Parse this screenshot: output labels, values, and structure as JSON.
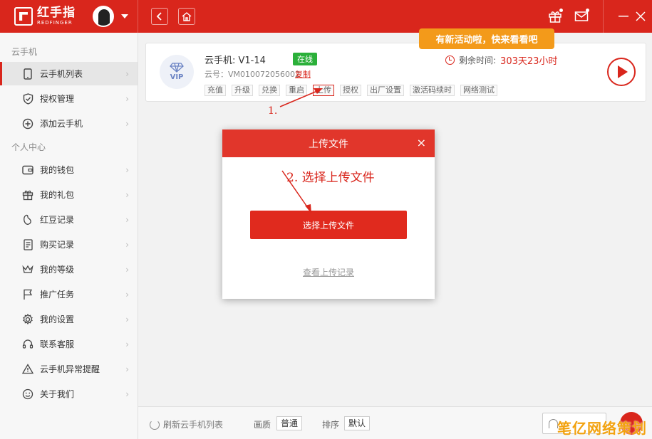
{
  "app": {
    "logo_cn": "红手指",
    "logo_en": "REDFINGER",
    "promo": "有新活动啦，快来看看吧"
  },
  "sidebar": {
    "group1": "云手机",
    "group2": "个人中心",
    "items": [
      {
        "label": "云手机列表",
        "icon": "phone-icon"
      },
      {
        "label": "授权管理",
        "icon": "shield-icon"
      },
      {
        "label": "添加云手机",
        "icon": "plus-circle-icon"
      },
      {
        "label": "我的钱包",
        "icon": "wallet-icon"
      },
      {
        "label": "我的礼包",
        "icon": "gift-icon"
      },
      {
        "label": "红豆记录",
        "icon": "bean-icon"
      },
      {
        "label": "购买记录",
        "icon": "document-icon"
      },
      {
        "label": "我的等级",
        "icon": "crown-icon"
      },
      {
        "label": "推广任务",
        "icon": "flag-icon"
      },
      {
        "label": "我的设置",
        "icon": "gear-icon"
      },
      {
        "label": "联系客服",
        "icon": "headset-icon"
      },
      {
        "label": "云手机异常提醒",
        "icon": "warning-icon"
      },
      {
        "label": "关于我们",
        "icon": "smile-icon"
      }
    ]
  },
  "phone": {
    "vip": "VIP",
    "name": "云手机: V1-14",
    "status": "在线",
    "id": "云号：VM010072056002",
    "copy": "复制",
    "remain_label": "剩余时间:",
    "remain_value": "303天23小时",
    "actions": [
      "充值",
      "升级",
      "兑换",
      "重启",
      "上传",
      "授权",
      "出厂设置",
      "激活码续时",
      "网络测试"
    ]
  },
  "annotations": {
    "step1": "1.",
    "step2": "2. 选择上传文件"
  },
  "modal": {
    "title": "上传文件",
    "close": "×",
    "button": "选择上传文件",
    "link": "查看上传记录"
  },
  "footer": {
    "refresh": "刷新云手机列表",
    "quality_label": "画质",
    "quality_value": "普通",
    "sort_label": "排序",
    "sort_value": "默认"
  },
  "watermark": "笔亿网络策划",
  "colors": {
    "brand": "#d9261c",
    "online": "#2bb03a",
    "promo": "#f39a1a"
  }
}
